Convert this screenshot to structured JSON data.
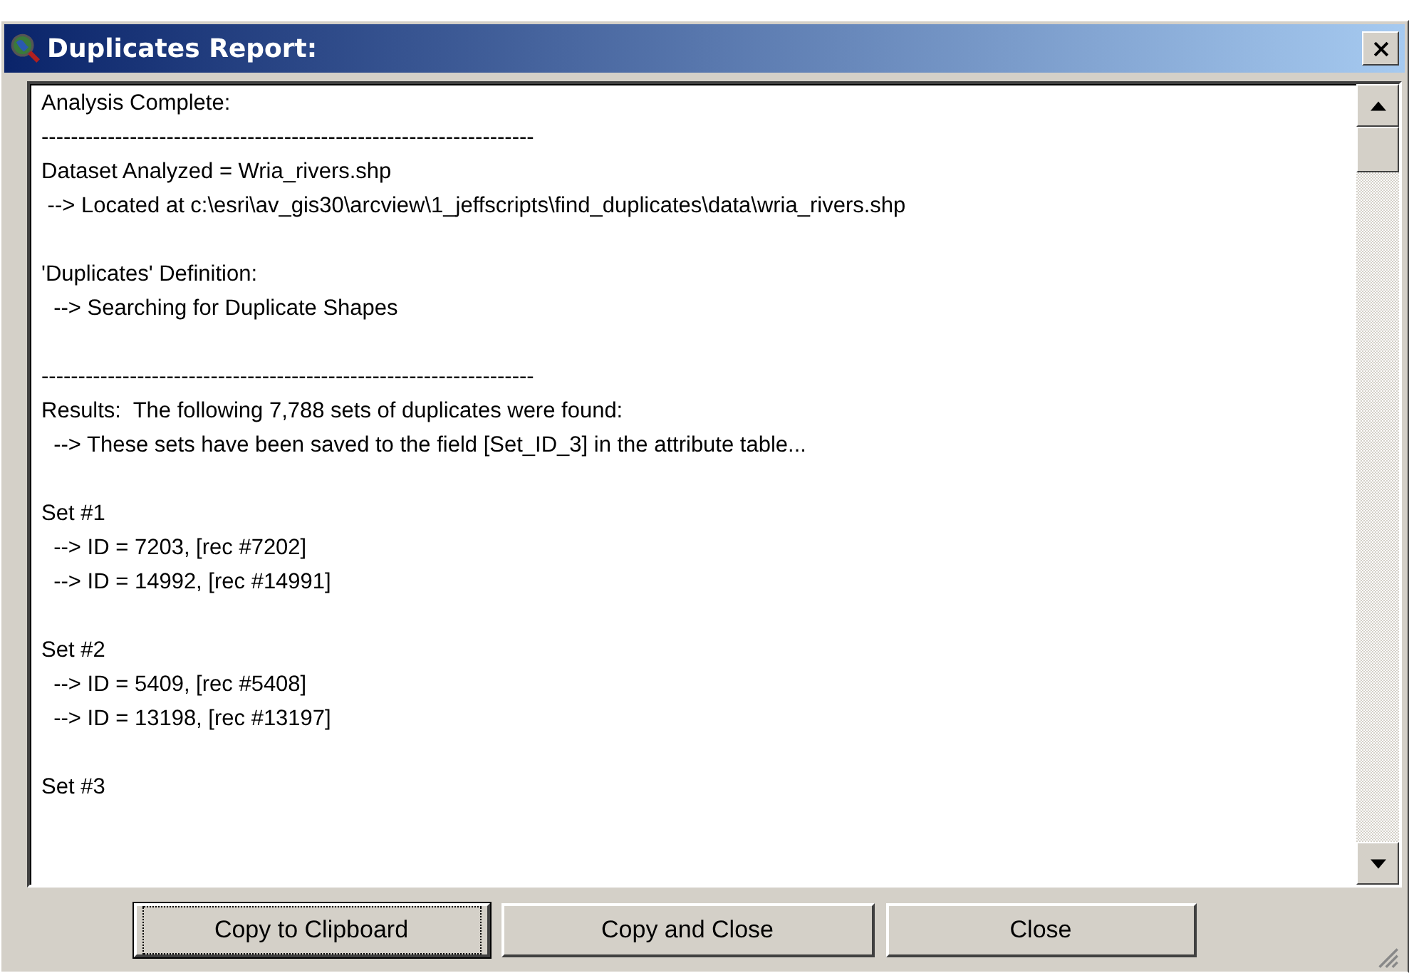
{
  "window": {
    "title": "Duplicates Report:"
  },
  "report": {
    "blocks": [
      [
        "Analysis Complete:",
        "-------------------------------------------------------------------",
        "Dataset Analyzed = Wria_rivers.shp",
        " --> Located at c:\\esri\\av_gis30\\arcview\\1_jeffscripts\\find_duplicates\\data\\wria_rivers.shp"
      ],
      [
        "'Duplicates' Definition:",
        "  --> Searching for Duplicate Shapes"
      ],
      [
        "-------------------------------------------------------------------",
        "Results:  The following 7,788 sets of duplicates were found:",
        "  --> These sets have been saved to the field [Set_ID_3] in the attribute table..."
      ],
      [
        "Set #1",
        "  --> ID = 7203, [rec #7202]",
        "  --> ID = 14992, [rec #14991]"
      ],
      [
        "Set #2",
        "  --> ID = 5409, [rec #5408]",
        "  --> ID = 13198, [rec #13197]"
      ],
      [
        "Set #3"
      ]
    ]
  },
  "buttons": [
    {
      "label": "Copy to Clipboard",
      "focused": true
    },
    {
      "label": "Copy and Close",
      "focused": false
    },
    {
      "label": "Close",
      "focused": false
    }
  ]
}
